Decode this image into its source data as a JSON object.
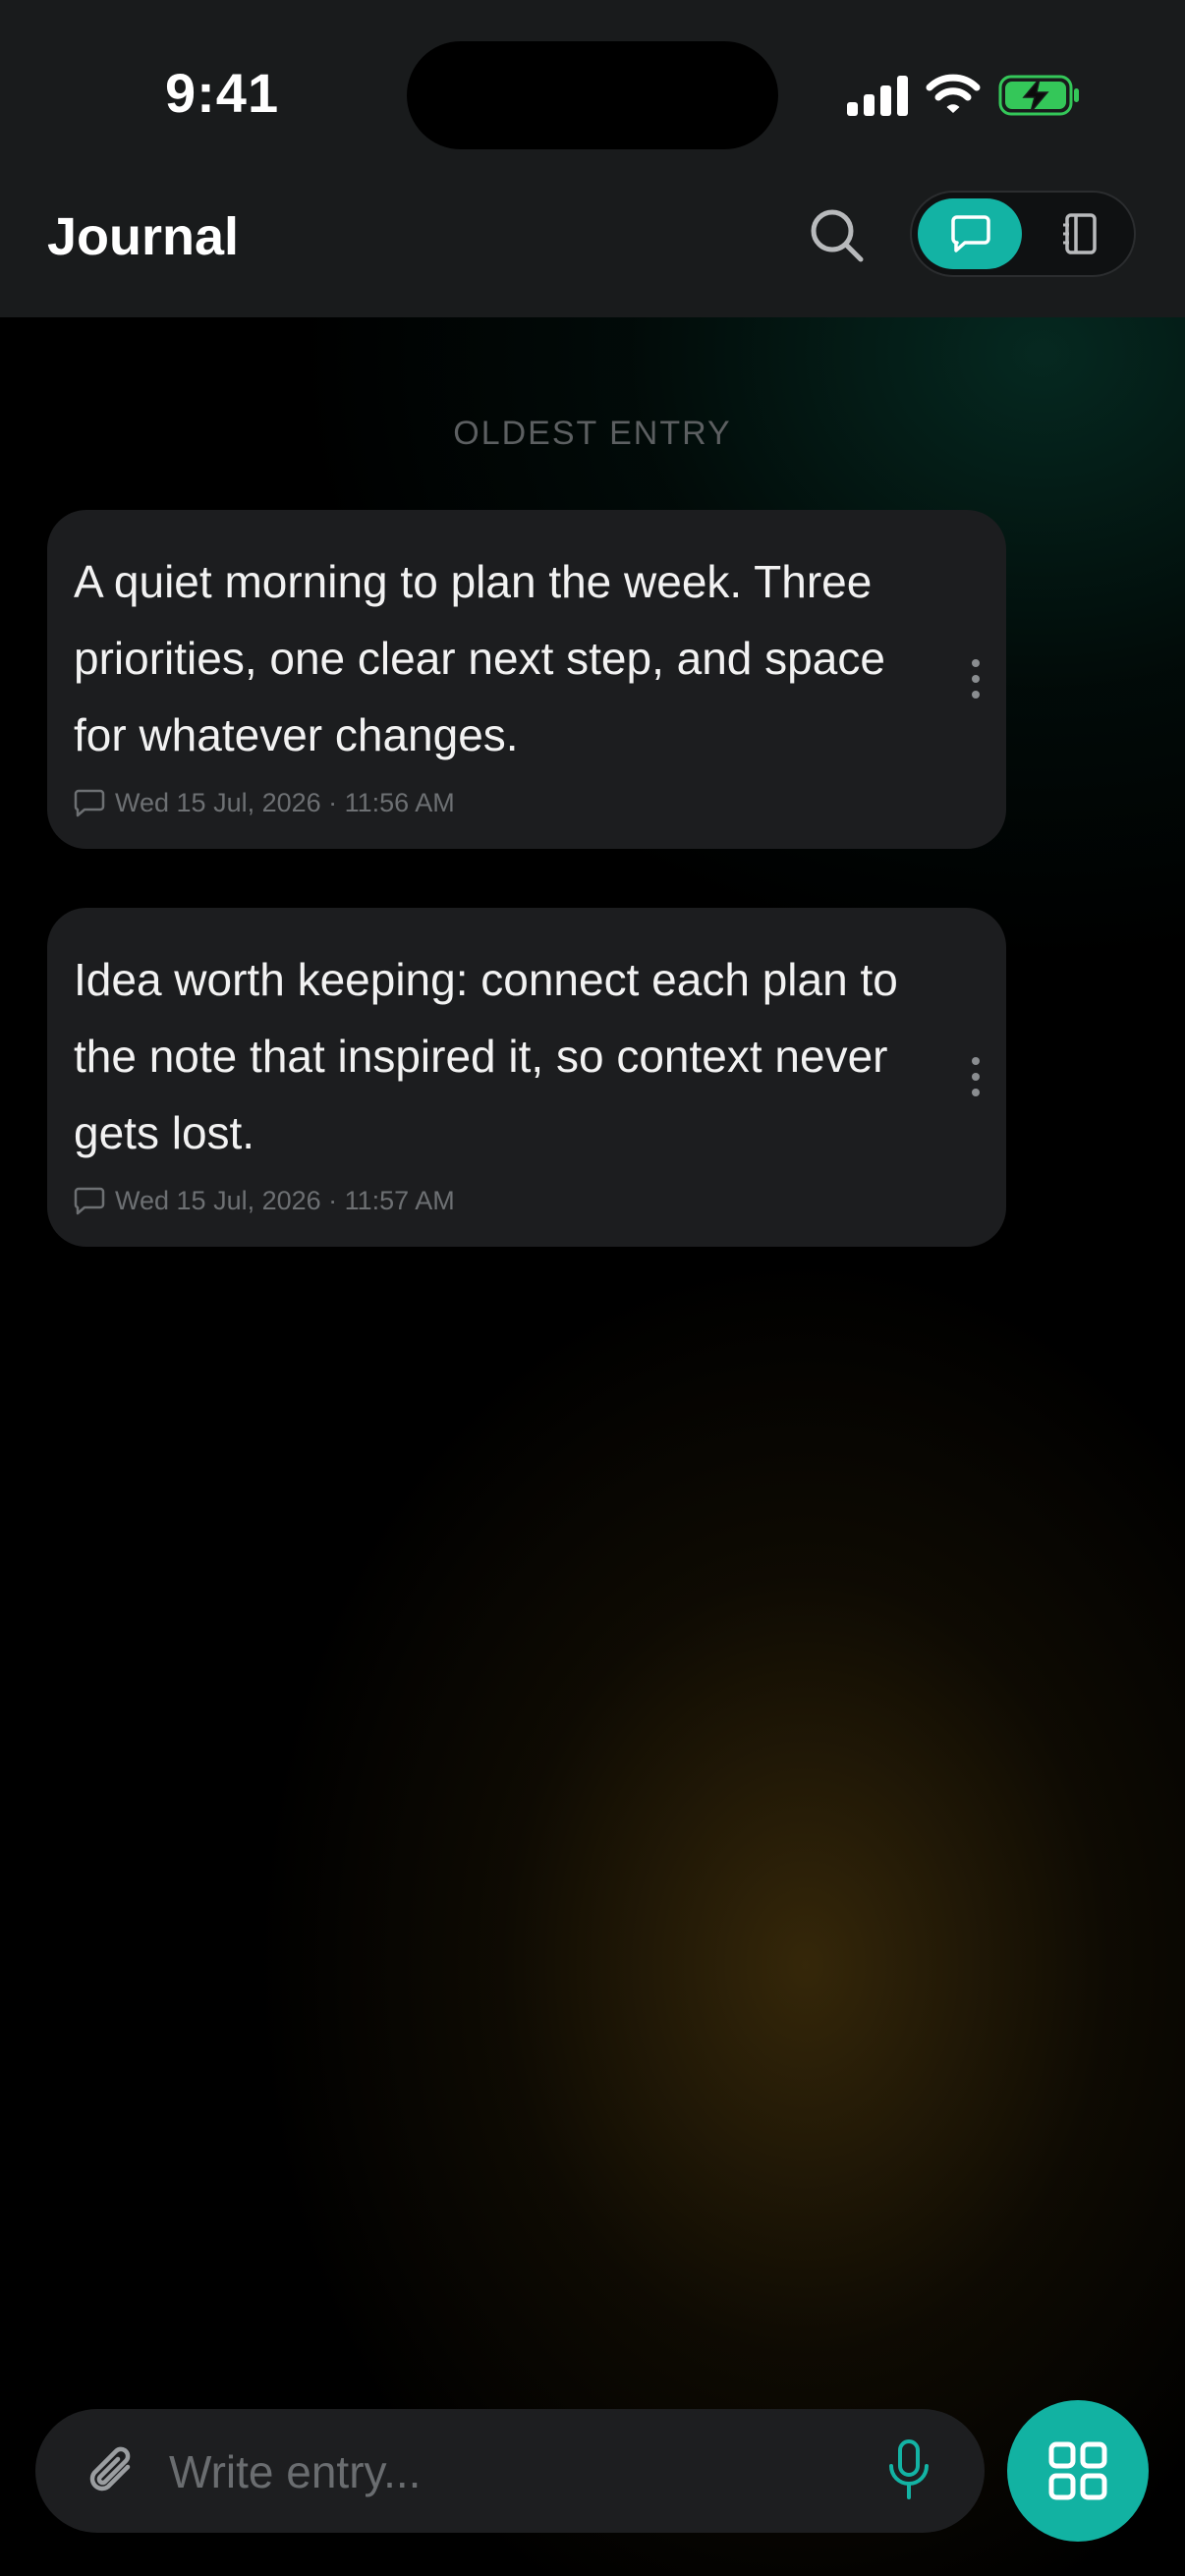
{
  "status_bar": {
    "time": "9:41"
  },
  "header": {
    "title": "Journal",
    "view_toggle": {
      "active": "chat",
      "options": [
        "chat-icon",
        "notebook-icon"
      ]
    }
  },
  "list": {
    "section_label": "OLDEST ENTRY",
    "entries": [
      {
        "text": "A quiet morning to plan the week. Three priorities, one clear next step, and space for whatever changes.",
        "timestamp": "Wed 15 Jul, 2026 · 11:56 AM"
      },
      {
        "text": "Idea worth keeping: connect each plan to the note that inspired it, so context never gets lost.",
        "timestamp": "Wed 15 Jul, 2026 · 11:57 AM"
      }
    ]
  },
  "composer": {
    "placeholder": "Write entry..."
  },
  "colors": {
    "accent": "#13b3a4",
    "battery": "#34c759",
    "card": "#1c1d1f",
    "header": "#191b1c"
  }
}
